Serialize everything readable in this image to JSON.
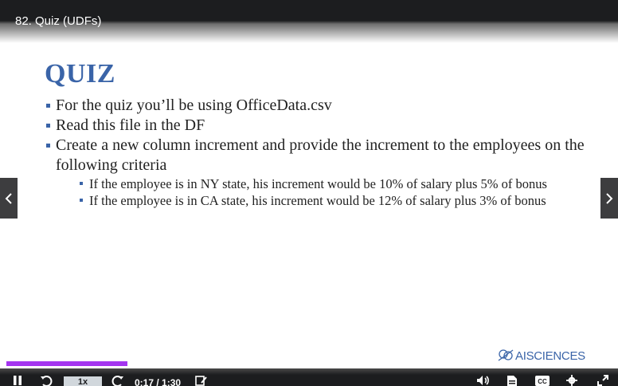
{
  "player": {
    "title": "82. Quiz (UDFs)",
    "progress_fraction": 0.2,
    "time_display": "0:17 / 1:30",
    "playback_rate": "1x",
    "accent_color": "#a435f0"
  },
  "slide": {
    "heading": "QUIZ",
    "bullets": [
      "For the quiz you’ll be using OfficeData.csv",
      "Read this file in the DF",
      "Create a new column increment and provide the increment to the employees on the following criteria"
    ],
    "sub_bullets": [
      "If the employee is in NY state, his increment would be 10% of salary plus 5% of bonus",
      "If the employee is in CA state, his increment would be 12% of salary plus 3% of bonus"
    ],
    "logo_text": "AISCIENCES",
    "heading_color": "#3a64a8"
  },
  "icons": {
    "prev": "chevron-left-icon",
    "next": "chevron-right-icon",
    "play_pause": "pause-icon",
    "rewind": "rewind-5-icon",
    "forward": "forward-5-icon",
    "notes": "add-note-icon",
    "volume": "volume-icon",
    "transcript": "transcript-icon",
    "captions": "captions-icon",
    "settings": "gear-icon",
    "fullscreen": "expand-icon"
  }
}
